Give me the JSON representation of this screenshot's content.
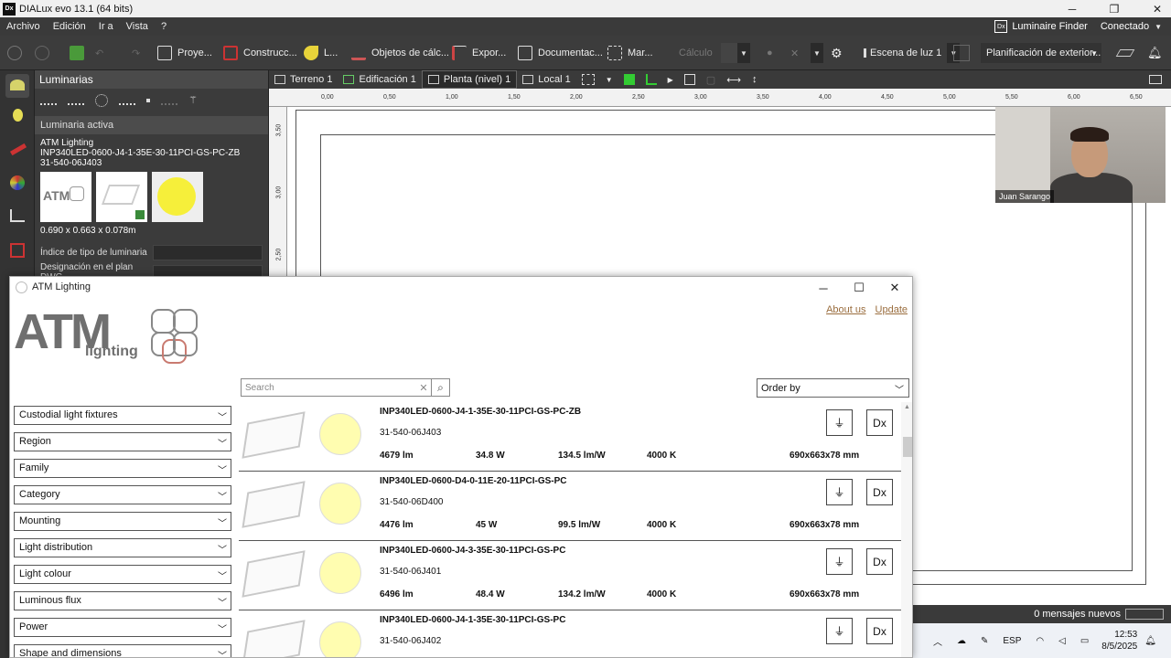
{
  "window": {
    "app_icon": "Dx",
    "title": "DIALux evo 13.1  (64 bits)"
  },
  "menu": {
    "items": [
      "Archivo",
      "Edición",
      "Ir a",
      "Vista",
      "?"
    ],
    "luminaire_finder": "Luminaire Finder",
    "luminaire_finder_icon": "Dx",
    "connection": "Conectado"
  },
  "toolbar": {
    "proyecto": "Proye...",
    "construccion": "Construcc...",
    "luz": "L...",
    "objetos": "Objetos de cálc...",
    "exportar": "Expor...",
    "documentacion": "Documentac...",
    "marcos": "Mar...",
    "calculo": "Cálculo",
    "escena": "Escena de luz 1",
    "planificacion": "Planificación de exterior..."
  },
  "left_panel": {
    "header": "Luminarias",
    "section": "Luminaria activa",
    "manufacturer": "ATM Lighting",
    "model": "INP340LED-0600-J4-1-35E-30-11PCI-GS-PC-ZB",
    "code": "31-540-06J403",
    "thumb_logo": "ATM",
    "dimensions": "0.690 x 0.663 x 0.078m",
    "field1_label": "Índice de tipo de luminaria",
    "field2_label": "Designación en el plan DWG"
  },
  "view_tabs": [
    "Terreno 1",
    "Edificación 1",
    "Planta (nivel) 1",
    "Local 1"
  ],
  "ruler": {
    "top_ticks": [
      "0,00",
      "0,50",
      "1,00",
      "1,50",
      "2,00",
      "2,50",
      "3,00",
      "3,50",
      "4,00",
      "4,50",
      "5,00",
      "5,50",
      "6,00",
      "6,50"
    ],
    "left_ticks": [
      "3,50",
      "3,00",
      "2,50"
    ]
  },
  "webcam": {
    "name": "Juan Sarango"
  },
  "status": {
    "messages": "0 mensajes nuevos",
    "lang": "ESP",
    "time": "12:53",
    "date": "8/5/2025"
  },
  "dialog": {
    "title": "ATM Lighting",
    "logo_text": "ATM",
    "logo_subtext": "lighting",
    "about": "About us",
    "update": "Update",
    "search_placeholder": "Search",
    "order_by": "Order by",
    "filters": [
      "Custodial light fixtures",
      "Region",
      "Family",
      "Category",
      "Mounting",
      "Light distribution",
      "Light colour",
      "Luminous flux",
      "Power",
      "Shape and dimensions"
    ],
    "dx_label": "Dx",
    "products": [
      {
        "name": "INP340LED-0600-J4-1-35E-30-11PCI-GS-PC-ZB",
        "code": "31-540-06J403",
        "flux": "4679 lm",
        "power": "34.8 W",
        "efficacy": "134.5 lm/W",
        "cct": "4000 K",
        "size": "690x663x78 mm"
      },
      {
        "name": "INP340LED-0600-D4-0-11E-20-11PCI-GS-PC",
        "code": "31-540-06D400",
        "flux": "4476 lm",
        "power": "45 W",
        "efficacy": "99.5 lm/W",
        "cct": "4000 K",
        "size": "690x663x78 mm"
      },
      {
        "name": "INP340LED-0600-J4-3-35E-30-11PCI-GS-PC",
        "code": "31-540-06J401",
        "flux": "6496 lm",
        "power": "48.4 W",
        "efficacy": "134.2 lm/W",
        "cct": "4000 K",
        "size": "690x663x78 mm"
      },
      {
        "name": "INP340LED-0600-J4-1-35E-30-11PCI-GS-PC",
        "code": "31-540-06J402",
        "flux": "",
        "power": "",
        "efficacy": "",
        "cct": "",
        "size": ""
      }
    ]
  }
}
